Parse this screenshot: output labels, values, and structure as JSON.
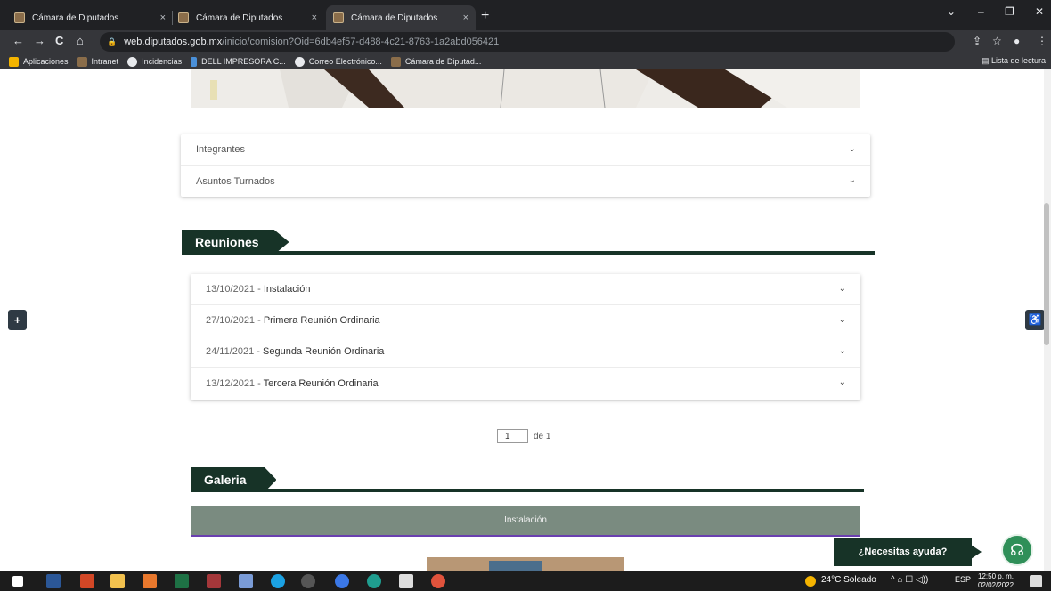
{
  "browser": {
    "tabs": [
      {
        "title": "Cámara de Diputados",
        "close": "×"
      },
      {
        "title": "Cámara de Diputados",
        "close": "×"
      },
      {
        "title": "Cámara de Diputados",
        "close": "×"
      }
    ],
    "new_tab": "+",
    "window_controls": [
      "⌄",
      "–",
      "❐",
      "✕"
    ],
    "nav": {
      "back": "←",
      "forward": "→",
      "reload": "C",
      "home": "⌂"
    },
    "url_host": "web.diputados.gob.mx",
    "url_path": "/inicio/comision?Oid=6db4ef57-d488-4c21-8763-1a2abd056421",
    "toolbar_icons": [
      "⇪",
      "☆",
      "●",
      "⋮"
    ],
    "bookmarks": [
      {
        "label": "Aplicaciones",
        "color": "#f4b400"
      },
      {
        "label": "Intranet",
        "color": "#8a6d4a"
      },
      {
        "label": "Incidencias",
        "color": "#e8eaed"
      },
      {
        "label": "DELL IMPRESORA C...",
        "color": "#4a90d9"
      },
      {
        "label": "Correo Electrónico...",
        "color": "#e8eaed"
      },
      {
        "label": "Cámara de Diputad...",
        "color": "#8a6d4a"
      }
    ],
    "reading_list": "Lista de lectura"
  },
  "accordion": {
    "items": [
      {
        "label": "Integrantes",
        "chevron": "⌄"
      },
      {
        "label": "Asuntos Turnados",
        "chevron": "⌄"
      }
    ]
  },
  "reuniones": {
    "heading": "Reuniones",
    "items": [
      {
        "date": "13/10/2021",
        "sep": " - ",
        "title": "Instalación"
      },
      {
        "date": "27/10/2021",
        "sep": " - ",
        "title": "Primera Reunión Ordinaria"
      },
      {
        "date": "24/11/2021",
        "sep": " - ",
        "title": "Segunda Reunión Ordinaria"
      },
      {
        "date": "13/12/2021",
        "sep": " - ",
        "title": "Tercera Reunión Ordinaria"
      }
    ],
    "pager": {
      "page": "1",
      "of_label": "de 1"
    }
  },
  "galeria": {
    "heading": "Galeria",
    "bar_label": "Instalación"
  },
  "side": {
    "plus": "+",
    "accessibility": "♿"
  },
  "help": {
    "label": "¿Necesitas ayuda?",
    "icon": "☊"
  },
  "taskbar": {
    "weather": "24°C Soleado",
    "lang": "ESP",
    "time": "12:50 p. m.",
    "date": "02/02/2022",
    "tray_icons": "^ ⌂ ☐ ◁))"
  }
}
